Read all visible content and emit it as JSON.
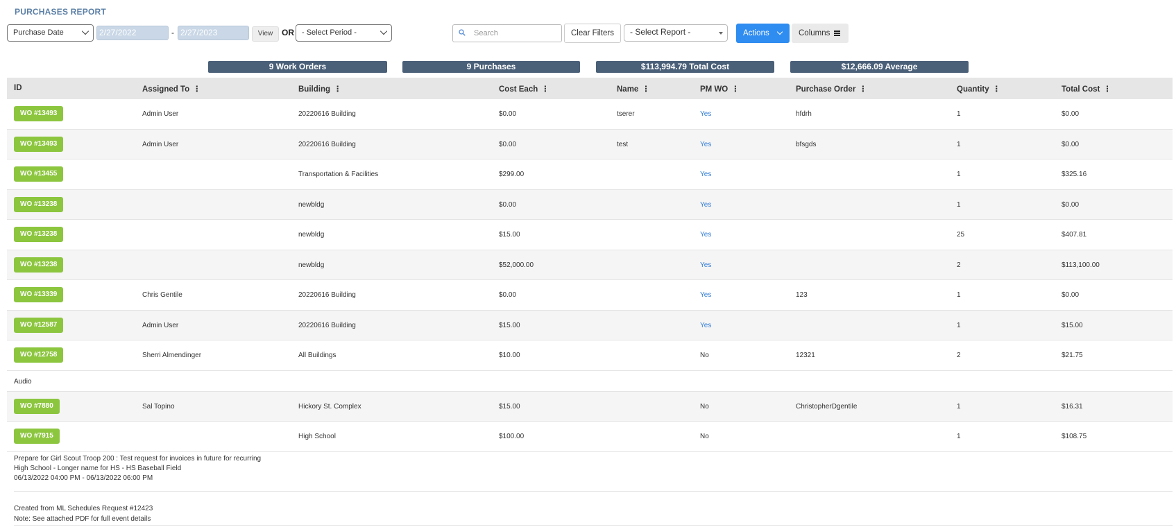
{
  "title": "PURCHASES REPORT",
  "filters": {
    "date_field": "Purchase Date",
    "start_date": "2/27/2022",
    "separator": "-",
    "end_date": "2/27/2023",
    "view_label": "View",
    "or_label": "OR",
    "period_placeholder": "- Select Period -",
    "search_placeholder": "Search",
    "clear_label": "Clear Filters",
    "report_placeholder": "- Select Report -",
    "actions_label": "Actions",
    "columns_label": "Columns"
  },
  "summary": {
    "work_orders": "9 Work Orders",
    "purchases": "9 Purchases",
    "total_cost": "$113,994.79 Total Cost",
    "average": "$12,666.09 Average"
  },
  "columns": [
    "ID",
    "Assigned To",
    "Building",
    "Cost Each",
    "Name",
    "PM WO",
    "Purchase Order",
    "Quantity",
    "Total Cost"
  ],
  "rows": [
    {
      "id": "WO #13493",
      "assigned": "Admin User",
      "building": "20220616 Building",
      "cost": "$0.00",
      "name": "tserer",
      "pm": "Yes",
      "po": "hfdrh",
      "qty": "1",
      "total": "$0.00"
    },
    {
      "id": "WO #13493",
      "assigned": "Admin User",
      "building": "20220616 Building",
      "cost": "$0.00",
      "name": "test",
      "pm": "Yes",
      "po": "bfsgds",
      "qty": "1",
      "total": "$0.00"
    },
    {
      "id": "WO #13455",
      "assigned": "",
      "building": "Transportation & Facilities",
      "cost": "$299.00",
      "name": "",
      "pm": "Yes",
      "po": "",
      "qty": "1",
      "total": "$325.16"
    },
    {
      "id": "WO #13238",
      "assigned": "",
      "building": "newbldg",
      "cost": "$0.00",
      "name": "",
      "pm": "Yes",
      "po": "",
      "qty": "1",
      "total": "$0.00"
    },
    {
      "id": "WO #13238",
      "assigned": "",
      "building": "newbldg",
      "cost": "$15.00",
      "name": "",
      "pm": "Yes",
      "po": "",
      "qty": "25",
      "total": "$407.81"
    },
    {
      "id": "WO #13238",
      "assigned": "",
      "building": "newbldg",
      "cost": "$52,000.00",
      "name": "",
      "pm": "Yes",
      "po": "",
      "qty": "2",
      "total": "$113,100.00"
    },
    {
      "id": "WO #13339",
      "assigned": "Chris Gentile",
      "building": "20220616 Building",
      "cost": "$0.00",
      "name": "",
      "pm": "Yes",
      "po": "123",
      "qty": "1",
      "total": "$0.00"
    },
    {
      "id": "WO #12587",
      "assigned": "Admin User",
      "building": "20220616 Building",
      "cost": "$15.00",
      "name": "",
      "pm": "Yes",
      "po": "",
      "qty": "1",
      "total": "$15.00"
    },
    {
      "id": "WO #12758",
      "assigned": "Sherri Almendinger",
      "building": "All Buildings",
      "cost": "$10.00",
      "name": "",
      "pm": "No",
      "po": "12321",
      "qty": "2",
      "total": "$21.75"
    }
  ],
  "note_audio": "Audio",
  "rows2": [
    {
      "id": "WO #7880",
      "assigned": "Sal Topino",
      "building": "Hickory St. Complex",
      "cost": "$15.00",
      "name": "",
      "pm": "No",
      "po": "ChristopherDgentile",
      "qty": "1",
      "total": "$16.31"
    },
    {
      "id": "WO #7915",
      "assigned": "",
      "building": "High School",
      "cost": "$100.00",
      "name": "",
      "pm": "No",
      "po": "",
      "qty": "1",
      "total": "$108.75"
    }
  ],
  "description": {
    "line1": "Prepare for Girl Scout Troop 200 : Test request for invoices in future for recurring",
    "line2": "High School - Longer name for HS - HS Baseball Field",
    "line3": "06/13/2022 04:00 PM - 06/13/2022 06:00 PM",
    "line4": "Created from ML Schedules Request #12423",
    "line5": "Note: See attached PDF for full event details"
  },
  "colors": {
    "accent_blue": "#2f8cf0",
    "wo_green": "#8cc63f",
    "pill_slate": "#4a5f78",
    "title_blue": "#5b7fa6",
    "link_blue": "#2f7bd6"
  }
}
